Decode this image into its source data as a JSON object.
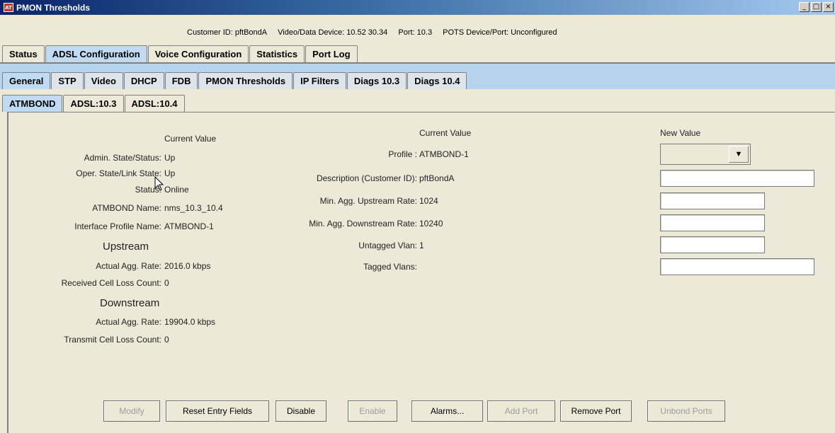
{
  "window": {
    "title": "PMON Thresholds",
    "icon": "AT",
    "controls": [
      "_",
      "□",
      "×"
    ]
  },
  "header_info": {
    "customer_id": "Customer ID: pftBondA",
    "device": "Video/Data Device: 10.52 30.34",
    "port": "Port: 10.3",
    "pots": "POTS Device/Port: Unconfigured"
  },
  "tabs_main": [
    "Status",
    "ADSL Configuration",
    "Voice Configuration",
    "Statistics",
    "Port Log"
  ],
  "tabs_sub": [
    "General",
    "STP",
    "Video",
    "DHCP",
    "FDB",
    "PMON Thresholds",
    "IP Filters",
    "Diags 10.3",
    "Diags 10.4"
  ],
  "tabs_port": [
    "ATMBOND",
    "ADSL:10.3",
    "ADSL:10.4"
  ],
  "left": {
    "current_value_header": "Current Value",
    "rows": [
      {
        "label": "Admin. State/Status:",
        "value": "Up"
      },
      {
        "label": "Oper. State/Link State:",
        "value": "Up"
      },
      {
        "label": "Status:",
        "value": "Online"
      },
      {
        "label": "ATMBOND Name:",
        "value": "nms_10.3_10.4"
      },
      {
        "label": "Interface Profile Name:",
        "value": "ATMBOND-1"
      }
    ],
    "upstream_title": "Upstream",
    "upstream": [
      {
        "label": "Actual Agg. Rate:",
        "value": "2016.0 kbps"
      },
      {
        "label": "Received Cell Loss Count:",
        "value": "0"
      }
    ],
    "downstream_title": "Downstream",
    "downstream": [
      {
        "label": "Actual Agg. Rate:",
        "value": "19904.0 kbps"
      },
      {
        "label": "Transmit Cell Loss Count:",
        "value": "0"
      }
    ]
  },
  "middle": {
    "current_value_header": "Current Value",
    "rows": [
      {
        "label": "Profile :",
        "value": "ATMBOND-1"
      },
      {
        "label": "Description (Customer ID):",
        "value": "pftBondA"
      },
      {
        "label": "Min. Agg. Upstream Rate:",
        "value": "1024"
      },
      {
        "label": "Min. Agg. Downstream Rate:",
        "value": "10240"
      },
      {
        "label": "Untagged Vlan:",
        "value": "1"
      },
      {
        "label": "Tagged Vlans:",
        "value": ""
      }
    ]
  },
  "right": {
    "new_value_header": "New Value",
    "profile_select": "",
    "description_input": "",
    "min_up_input": "",
    "min_down_input": "",
    "untagged_input": "",
    "tagged_input": ""
  },
  "buttons": {
    "modify": "Modify",
    "reset": "Reset Entry Fields",
    "disable": "Disable",
    "enable": "Enable",
    "alarms": "Alarms...",
    "add_port": "Add Port",
    "remove_port": "Remove Port",
    "unbond_ports": "Unbond Ports"
  }
}
